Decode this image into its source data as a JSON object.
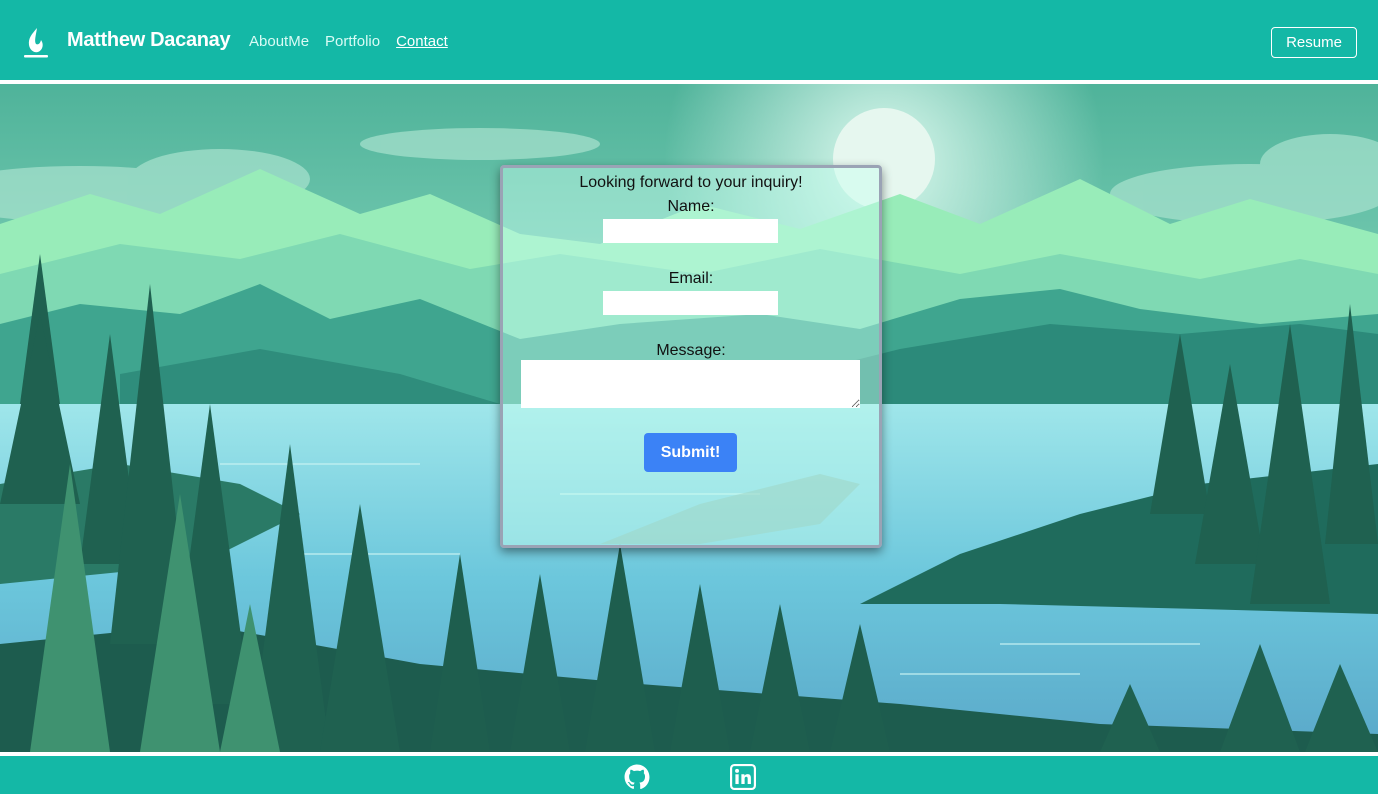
{
  "header": {
    "brand_name": "Matthew Dacanay",
    "nav": [
      "AboutMe",
      "Portfolio",
      "Contact"
    ],
    "active_nav": "Contact",
    "resume_label": "Resume"
  },
  "contact_form": {
    "title": "Looking forward to your inquiry!",
    "name_label": "Name:",
    "name_value": "",
    "email_label": "Email:",
    "email_value": "",
    "message_label": "Message:",
    "message_value": "",
    "submit_label": "Submit!"
  },
  "footer": {
    "icons": [
      "github-icon",
      "linkedin-icon"
    ]
  },
  "colors": {
    "header_bg": "#14b8a6",
    "footer_bg": "#14b8a6",
    "submit_bg": "#3b82f6",
    "card_border": "#9aa3b5"
  }
}
